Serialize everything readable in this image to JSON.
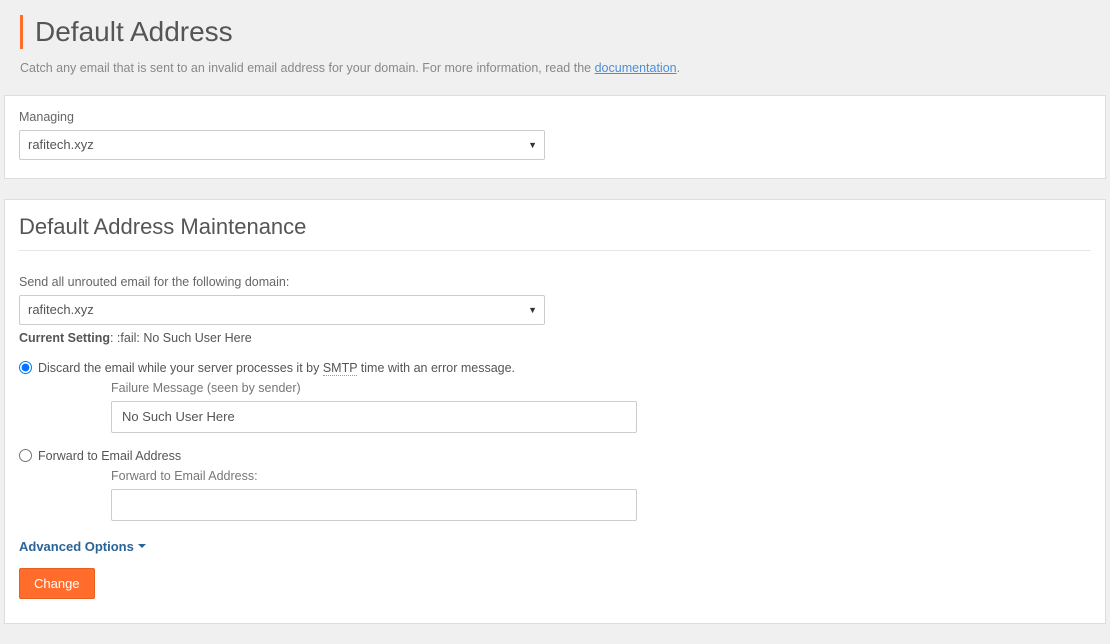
{
  "header": {
    "title": "Default Address",
    "desc_pre": "Catch any email that is sent to an invalid email address for your domain. For more information, read the ",
    "doc_link_text": "documentation",
    "desc_post": "."
  },
  "managing_panel": {
    "label": "Managing",
    "selected": "rafitech.xyz"
  },
  "maintenance": {
    "title": "Default Address Maintenance",
    "domain_label": "Send all unrouted email for the following domain:",
    "domain_selected": "rafitech.xyz",
    "current_setting_label": "Current Setting",
    "current_setting_value": ": :fail: No Such User Here",
    "discard": {
      "label_pre": "Discard the email while your server processes it by ",
      "smtp": "SMTP",
      "label_post": " time with an error message.",
      "failure_label": "Failure Message (seen by sender)",
      "failure_value": "No Such User Here"
    },
    "forward": {
      "label": "Forward to Email Address",
      "field_label": "Forward to Email Address:",
      "field_value": ""
    },
    "advanced_label": "Advanced Options",
    "change_button": "Change"
  }
}
